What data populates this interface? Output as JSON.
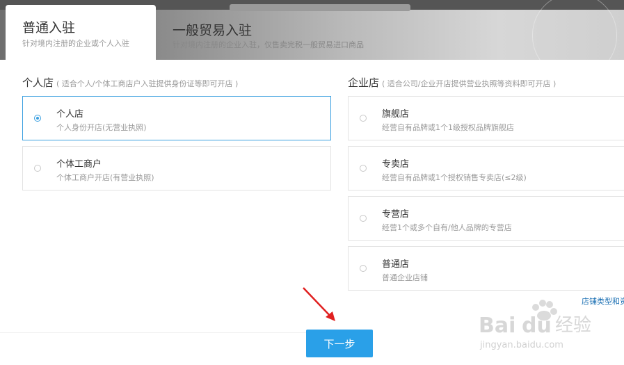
{
  "tabs": [
    {
      "title": "普通入驻",
      "subtitle": "针对境内注册的企业或个人入驻",
      "active": true
    },
    {
      "title": "一般贸易入驻",
      "subtitle": "针对境内注册的企业入驻，仅售卖完税一般贸易进口商品",
      "active": false
    }
  ],
  "personal": {
    "title": "个人店",
    "hint": "( 适合个人/个体工商店户入驻提供身份证等即可开店 )",
    "options": [
      {
        "title": "个人店",
        "desc": "个人身份开店(无营业执照)",
        "selected": true
      },
      {
        "title": "个体工商户",
        "desc": "个体工商户开店(有营业执照)",
        "selected": false
      }
    ]
  },
  "enterprise": {
    "title": "企业店",
    "hint": "( 适合公司/企业开店提供营业执照等资料即可开店 )",
    "options": [
      {
        "title": "旗舰店",
        "desc": "经营自有品牌或1个1级授权品牌旗舰店",
        "selected": false
      },
      {
        "title": "专卖店",
        "desc": "经营自有品牌或1个授权销售专卖店(≤2级)",
        "selected": false
      },
      {
        "title": "专营店",
        "desc": "经营1个或多个自有/他人品牌的专营店",
        "selected": false
      },
      {
        "title": "普通店",
        "desc": "普通企业店铺",
        "selected": false
      }
    ]
  },
  "store_type_link": "店铺类型和资",
  "next_button": "下一步",
  "watermark": {
    "brand": "Baidu 经验",
    "url": "jingyan.baidu.com"
  },
  "colors": {
    "accent": "#2aa0e8",
    "selected_border": "#3a9fe0",
    "arrow": "#e02020"
  }
}
